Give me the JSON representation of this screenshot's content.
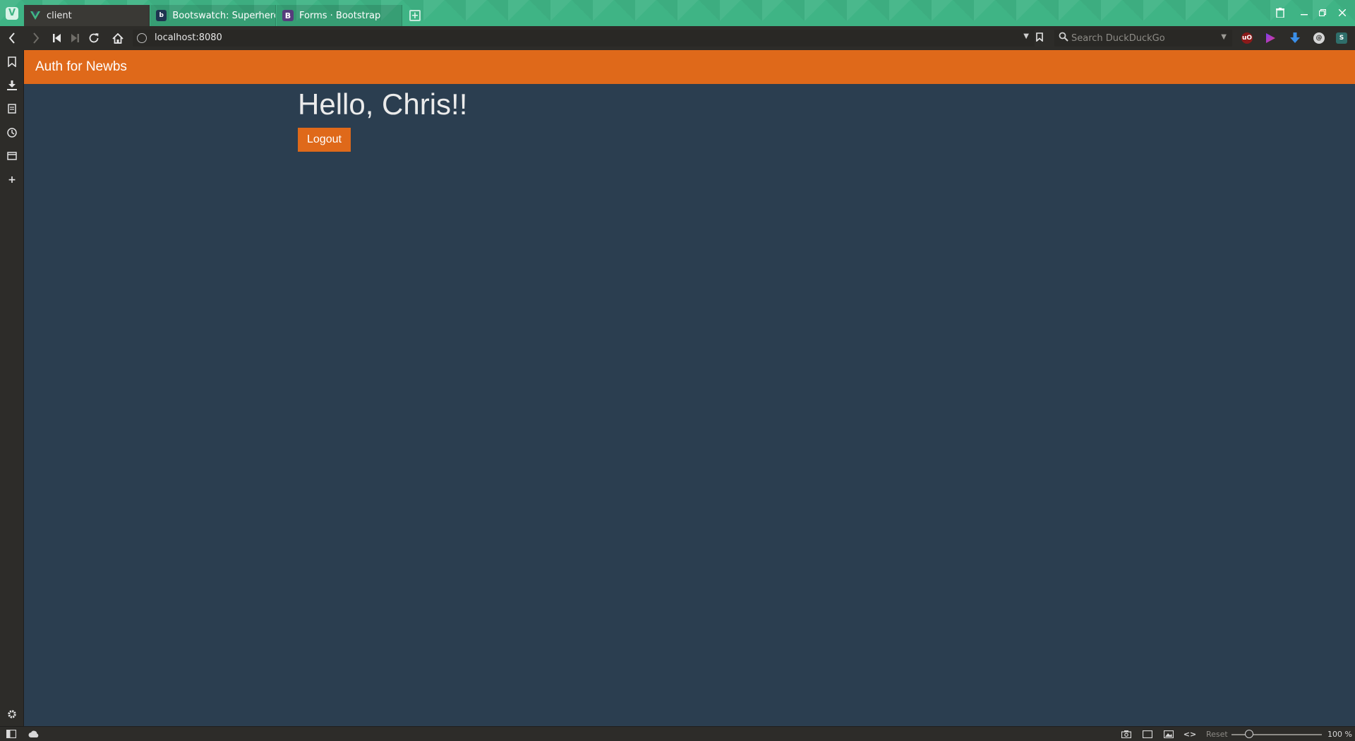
{
  "browser": {
    "tabs": [
      {
        "label": "client",
        "favicon": "vue-logo-icon",
        "active": true
      },
      {
        "label": "Bootswatch: Superhero",
        "favicon": "bootswatch-icon",
        "active": false
      },
      {
        "label": "Forms · Bootstrap",
        "favicon": "bootstrap-icon",
        "active": false
      }
    ],
    "url": "localhost:8080",
    "search_placeholder": "Search DuckDuckGo",
    "zoom_reset_label": "Reset",
    "zoom_level": "100 %",
    "accent_color": "#3fb485"
  },
  "page": {
    "brand": "Auth for Newbs",
    "greeting": "Hello, Chris!!",
    "logout_label": "Logout",
    "navbar_color": "#df691a",
    "background_color": "#2b3e50"
  }
}
